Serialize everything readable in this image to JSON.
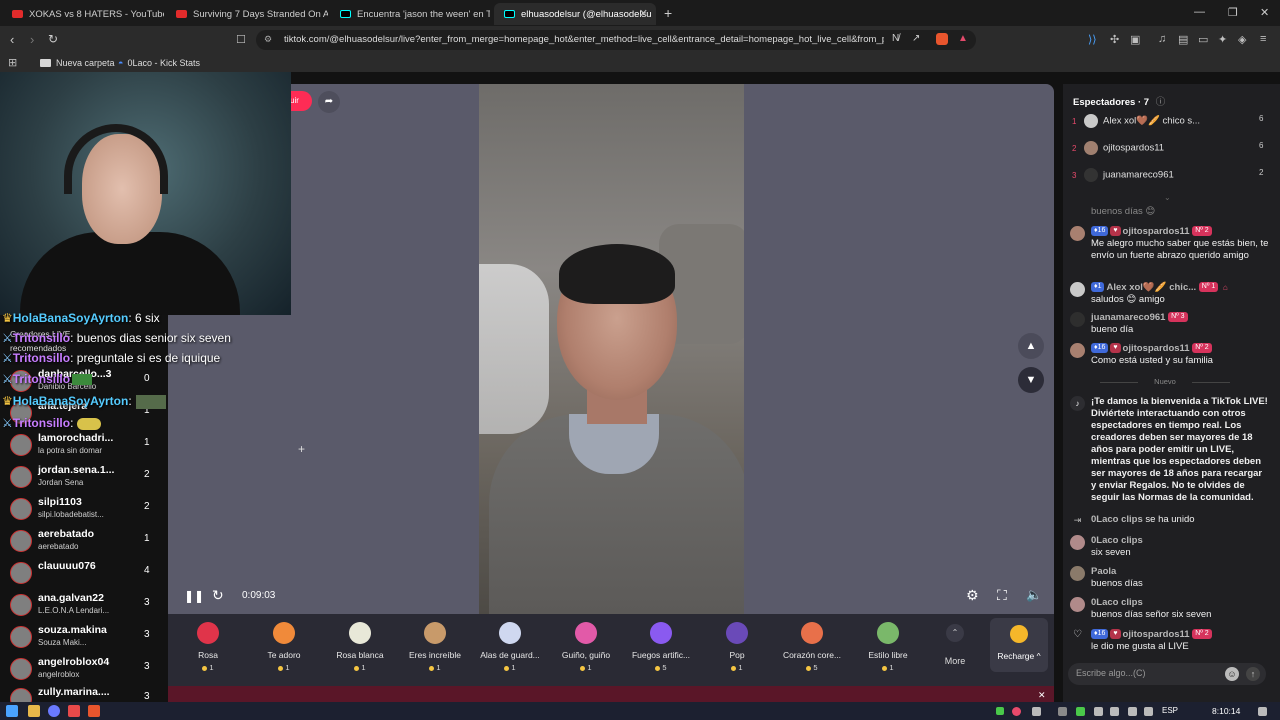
{
  "browser": {
    "tabs": [
      {
        "title": "XOKAS vs 8 HATERS - YouTube",
        "color": "#e22b2b"
      },
      {
        "title": "Surviving 7 Days Stranded On An Isla",
        "color": "#e22b2b"
      },
      {
        "title": "Encuentra 'jason the ween' en TikTok",
        "color": "#111111"
      },
      {
        "title": "elhuasodelsur (@elhuasodelsu",
        "color": "#111111"
      }
    ],
    "url": "tiktok.com/@elhuasodelsur/live?enter_from_merge=homepage_hot&enter_method=live_cell&entrance_detail=homepage_hot_live_cell&from_p...",
    "bookmarks": [
      "Nueva carpeta",
      "0Laco - Kick Stats"
    ]
  },
  "player": {
    "timer": "0:09:03",
    "follow_label": "uir"
  },
  "gifts": [
    {
      "name": "Rosa",
      "cost": "1",
      "color": "#e0344a"
    },
    {
      "name": "Te adoro",
      "cost": "1",
      "color": "#f08a3a"
    },
    {
      "name": "Rosa blanca",
      "cost": "1",
      "color": "#e8e8d8"
    },
    {
      "name": "Eres increíble",
      "cost": "1",
      "color": "#c89a6a"
    },
    {
      "name": "Alas de guard...",
      "cost": "1",
      "color": "#cfd8f0"
    },
    {
      "name": "Guiño, guiño",
      "cost": "1",
      "color": "#e25aa8"
    },
    {
      "name": "Fuegos artific...",
      "cost": "5",
      "color": "#8a5af0"
    },
    {
      "name": "Pop",
      "cost": "1",
      "color": "#6a4ab8"
    },
    {
      "name": "Corazón core...",
      "cost": "5",
      "color": "#e8704a"
    },
    {
      "name": "Estilo libre",
      "cost": "1",
      "color": "#7ab86a"
    }
  ],
  "more_label": "More",
  "recharge_label": "Recharge ^",
  "viewers": {
    "title": "Espectadores · 7",
    "list": [
      {
        "rank": "1",
        "name": "Alex xol🤎🥖 chico s...",
        "count": "6"
      },
      {
        "rank": "2",
        "name": "ojitospardos11",
        "count": "6"
      },
      {
        "rank": "3",
        "name": "juanamareco961",
        "count": "2"
      }
    ]
  },
  "chat": {
    "partial": "buenos días 😊",
    "messages": [
      {
        "user": "ojitospardos11",
        "lvl": "16",
        "top": "Nº 2",
        "text": "Me alegro mucho saber que estás bien, te envío un fuerte abrazo querido amigo"
      },
      {
        "user": "Alex xol🤎🥖 chic...",
        "lvl": "1",
        "top": "Nº 1",
        "text": "saludos 😊 amigo"
      },
      {
        "user": "juanamareco961",
        "lvl": "",
        "top": "Nº 3",
        "text": "bueno día"
      },
      {
        "user": "ojitospardos11",
        "lvl": "16",
        "top": "Nº 2",
        "text": "Como está usted y su familia"
      }
    ],
    "new_label": "Nuevo",
    "welcome": "¡Te damos la bienvenida a TikTok LIVE! Diviértete interactuando con otros espectadores en tiempo real. Los creadores deben ser mayores de 18 años para poder emitir un LIVE, mientras que los espectadores deben ser mayores de 18 años para recargar y enviar Regalos. No te olvides de seguir las Normas de la comunidad.",
    "joined": {
      "user": "0Laco clips",
      "text": "se ha unido"
    },
    "later": [
      {
        "user": "0Laco clips",
        "text": "six seven"
      },
      {
        "user": "Paola",
        "text": "buenos días"
      },
      {
        "user": "0Laco clips",
        "text": "buenos días señor six seven"
      }
    ],
    "like": {
      "user": "ojitospardos11",
      "lvl": "16",
      "top": "Nº 2",
      "text": "le dio me gusta al LIVE"
    },
    "input_placeholder": "Escribe algo...(C)"
  },
  "overlay": {
    "chat": [
      {
        "user": "HolaBanaSoyAyrton",
        "text": ": 6 six",
        "color": "#5cf"
      },
      {
        "user": "Tritonsillo",
        "text": ": buenos dias senior six seven",
        "color": "#c77dff"
      },
      {
        "user": "Tritonsillo",
        "text": ": preguntale si es de iquique",
        "color": "#c77dff"
      },
      {
        "user": "Tritonsillo",
        "text": "",
        "color": "#c77dff"
      },
      {
        "user": "HolaBanaSoyAyrton",
        "text": ":",
        "color": "#5cf"
      },
      {
        "user": "Tritonsillo",
        "text": ":",
        "color": "#c77dff"
      }
    ],
    "subs": [
      "Creadores LIVE",
      "recomendados"
    ],
    "leaderboard": [
      {
        "name": "danbarcello...3",
        "sub": "Danibio Barcello",
        "num": "0"
      },
      {
        "name": "ana.tejera",
        "sub": "",
        "num": "1"
      },
      {
        "name": "lamorochadri...",
        "sub": "la potra sin domar",
        "num": "1"
      },
      {
        "name": "jordan.sena.1...",
        "sub": "Jordan Sena",
        "num": "2"
      },
      {
        "name": "silpi1103",
        "sub": "silpi.lobadebatist...",
        "num": "2"
      },
      {
        "name": "aerebatado",
        "sub": "aerebatado",
        "num": "1"
      },
      {
        "name": "clauuuu076",
        "sub": "",
        "num": "4"
      },
      {
        "name": "ana.galvan22",
        "sub": "L.E.O.N.A Lendari...",
        "num": "3"
      },
      {
        "name": "souza.makina",
        "sub": "Souza Maki...",
        "num": "3"
      },
      {
        "name": "angelroblox04",
        "sub": "angelroblox",
        "num": "3"
      },
      {
        "name": "zully.marina....",
        "sub": "",
        "num": "3"
      }
    ]
  },
  "taskbar": {
    "lang": "ESP",
    "time": "8:10:14"
  }
}
